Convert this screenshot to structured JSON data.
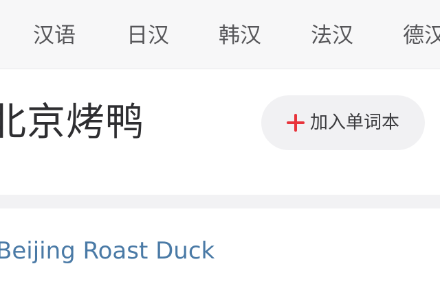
{
  "tabs": [
    {
      "label": "汉语"
    },
    {
      "label": "日汉"
    },
    {
      "label": "韩汉"
    },
    {
      "label": "法汉"
    },
    {
      "label": "德汉"
    }
  ],
  "entry": {
    "headword": "北京烤鸭",
    "add_button_label": "加入单词本",
    "add_icon": "plus-icon",
    "translation": "Beijing Roast Duck"
  },
  "colors": {
    "accent_red": "#e8343b",
    "link_blue": "#4a7aa6",
    "tab_text": "#555558",
    "headword_text": "#2e2e31"
  }
}
